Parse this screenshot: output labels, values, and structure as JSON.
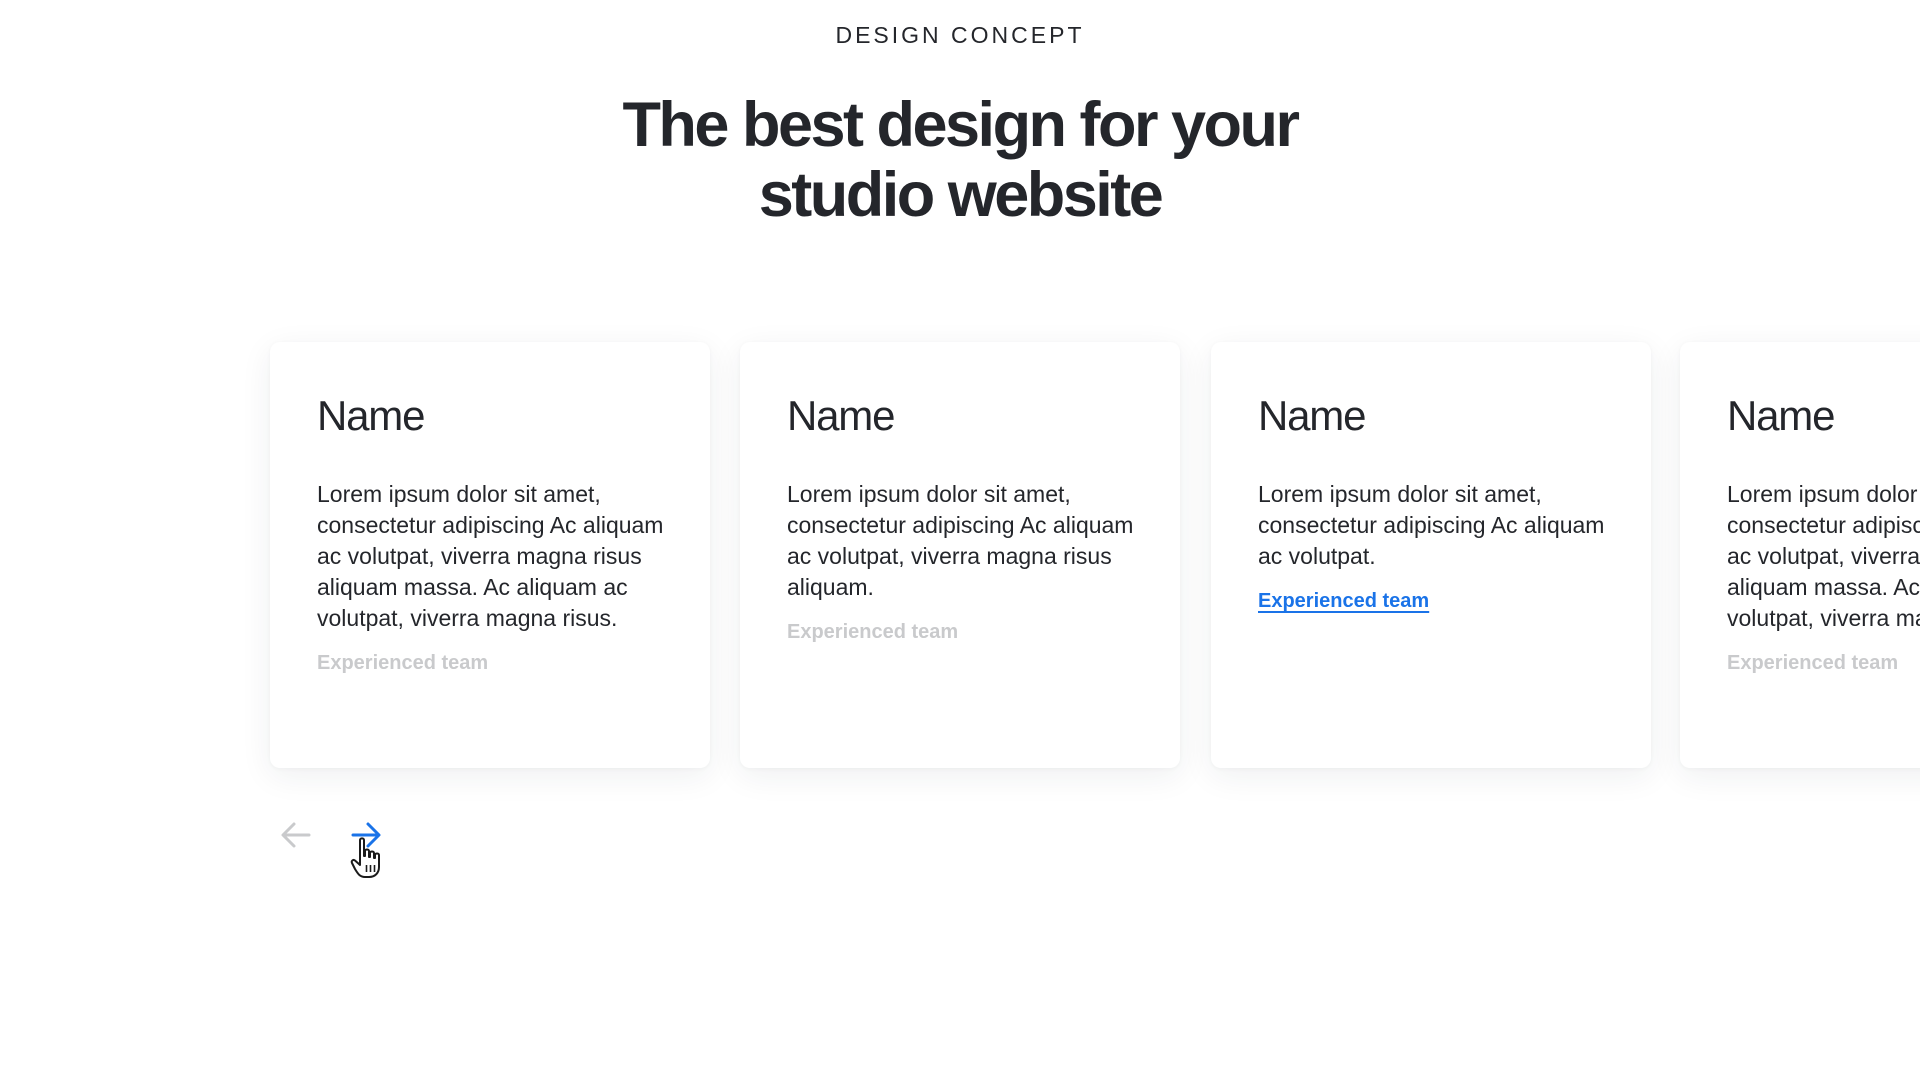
{
  "header": {
    "eyebrow": "DESIGN CONCEPT",
    "headline_line1": "The best design for your",
    "headline_line2": "studio website"
  },
  "cards": [
    {
      "title": "Name",
      "text": "Lorem ipsum dolor sit amet, consectetur adipiscing Ac aliquam ac volutpat, viverra magna risus aliquam massa. Ac aliquam ac volutpat, viverra magna risus.",
      "link": "Experienced team",
      "link_state": "inactive"
    },
    {
      "title": "Name",
      "text": "Lorem ipsum dolor sit amet, consectetur adipiscing Ac aliquam ac volutpat, viverra magna risus aliquam.",
      "link": "Experienced team",
      "link_state": "inactive"
    },
    {
      "title": "Name",
      "text": "Lorem ipsum dolor sit amet, consectetur adipiscing Ac aliquam ac volutpat.",
      "link": "Experienced team",
      "link_state": "active"
    },
    {
      "title": "Name",
      "text": "Lorem ipsum dolor sit amet, consectetur adipiscing Ac aliquam ac volutpat, viverra magna risus aliquam massa. Ac aliquam ac volutpat, viverra magna risus.",
      "link": "Experienced team",
      "link_state": "inactive"
    }
  ],
  "navigation": {
    "prev_icon": "arrow-left-icon",
    "next_icon": "arrow-right-icon",
    "cursor_icon": "hand-pointer-icon"
  },
  "colors": {
    "text": "#24262b",
    "accent": "#1a73e8",
    "muted": "#c9cacc",
    "background": "#ffffff"
  }
}
